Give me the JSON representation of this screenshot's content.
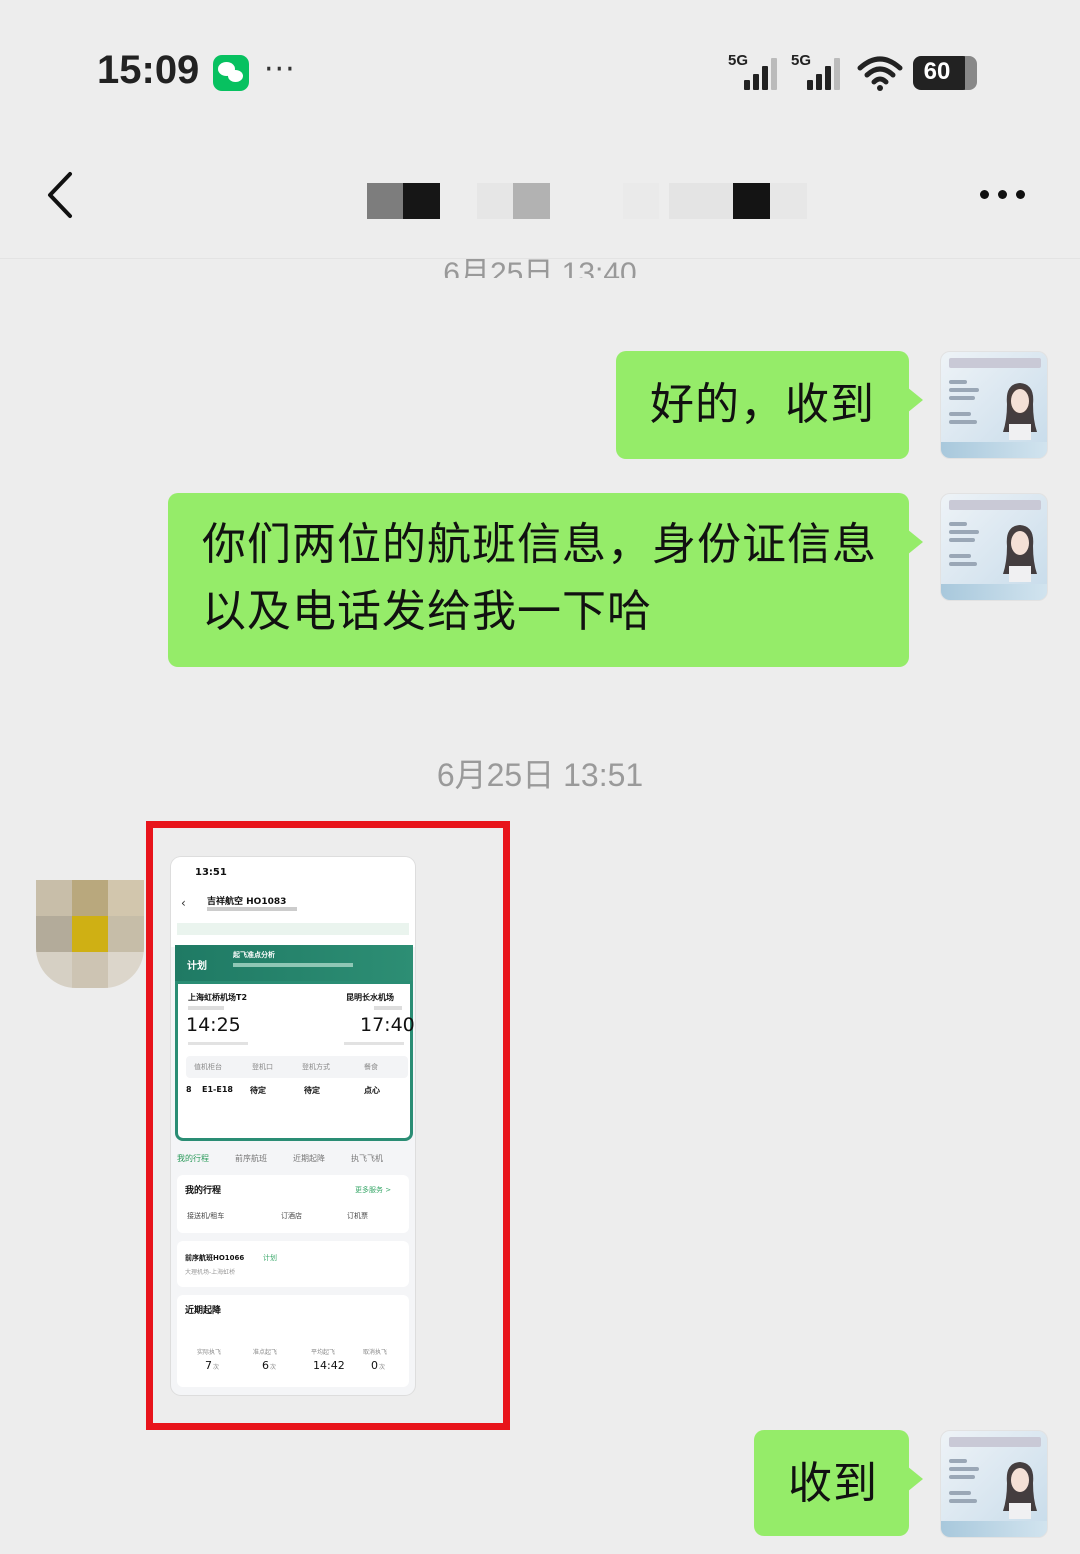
{
  "status_bar": {
    "time": "15:09",
    "notification_app_icon": "wechat-icon",
    "overflow": "···",
    "signal_1_label": "5G",
    "signal_2_label": "5G",
    "wifi_icon": "wifi-icon",
    "battery_level": "60"
  },
  "nav": {
    "back_icon": "chevron-left-icon",
    "more_icon": "more-icon",
    "title_blurred": true
  },
  "clipped_timestamp": "6月25日 13:40",
  "messages": [
    {
      "side": "right",
      "text_lines": [
        "好的，收到"
      ]
    },
    {
      "side": "right",
      "text_lines": [
        "你们两位的航班信息，身份证信息",
        "以及电话发给我一下哈"
      ]
    },
    {
      "side": "right",
      "text_lines": [
        "收到"
      ]
    }
  ],
  "timestamp": "6月25日 13:51",
  "shared_image": {
    "status_time": "13:51",
    "flight_title": "吉祥航空 HO1083",
    "banner_label": "计划",
    "banner_text": "起飞准点分析",
    "from_airport": "上海虹桥机场T2",
    "to_airport": "昆明长水机场",
    "dep_time": "14:25",
    "arr_time": "17:40",
    "row_labels": [
      "值机柜台",
      "登机口",
      "登机方式",
      "餐食"
    ],
    "row_values": [
      "8",
      "E1-E18",
      "待定",
      "待定",
      "点心"
    ],
    "tabs": [
      "我的行程",
      "前序航班",
      "近期起降",
      "执飞飞机"
    ],
    "my_trip": "我的行程",
    "more_service": "更多服务 >",
    "trip_options": [
      "接送机/租车",
      "订酒店",
      "订机票"
    ],
    "prev_flight": "前序航班HO1066",
    "prev_flight_status": "计划",
    "prev_route": "大理机场-上海虹桥",
    "recent_title": "近期起降",
    "stats_labels": [
      "实际执飞",
      "准点起飞",
      "平均起飞",
      "取消执飞"
    ],
    "stats_values": [
      "7",
      "6",
      "14:42",
      "0"
    ],
    "stats_units": [
      "次",
      "次",
      "",
      "次"
    ]
  },
  "highlight_color": "#e8141b",
  "bubble_color": "#95ec69"
}
